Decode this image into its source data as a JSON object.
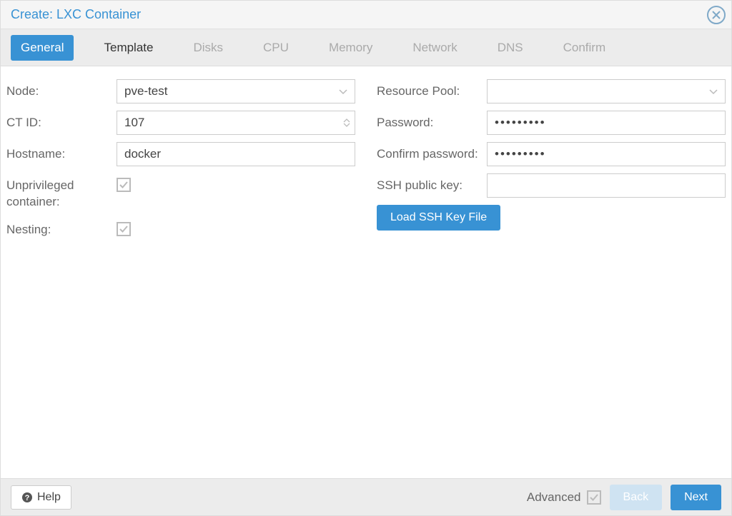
{
  "title": "Create: LXC Container",
  "tabs": [
    "General",
    "Template",
    "Disks",
    "CPU",
    "Memory",
    "Network",
    "DNS",
    "Confirm"
  ],
  "active_tab_index": 0,
  "enabled_tab_indices": [
    0,
    1
  ],
  "left": {
    "node_label": "Node:",
    "node_value": "pve-test",
    "ctid_label": "CT ID:",
    "ctid_value": "107",
    "hostname_label": "Hostname:",
    "hostname_value": "docker",
    "unpriv_label": "Unprivileged container:",
    "unpriv_checked": true,
    "nesting_label": "Nesting:",
    "nesting_checked": true
  },
  "right": {
    "pool_label": "Resource Pool:",
    "pool_value": "",
    "password_label": "Password:",
    "password_value": "•••••••••",
    "confirm_label": "Confirm password:",
    "confirm_value": "•••••••••",
    "ssh_label": "SSH public key:",
    "ssh_value": "",
    "load_ssh_label": "Load SSH Key File"
  },
  "footer": {
    "help_label": "Help",
    "advanced_label": "Advanced",
    "advanced_checked": true,
    "back_label": "Back",
    "next_label": "Next"
  }
}
